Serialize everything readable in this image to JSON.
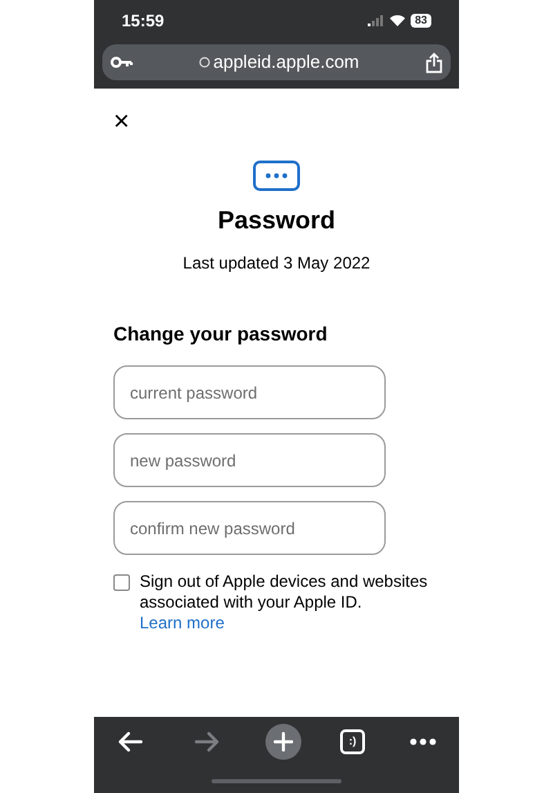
{
  "status_bar": {
    "time": "15:59",
    "battery": "83"
  },
  "address_bar": {
    "url": "appleid.apple.com"
  },
  "page": {
    "close": "×",
    "title": "Password",
    "subtitle": "Last updated 3 May 2022",
    "section_title": "Change your password",
    "fields": [
      {
        "placeholder": "current password"
      },
      {
        "placeholder": "new password"
      },
      {
        "placeholder": "confirm new password"
      }
    ],
    "sign_out": {
      "checked": false,
      "text": "Sign out of Apple devices and websites associated with your Apple ID.",
      "link": "Learn more"
    }
  },
  "toolbar": [
    {
      "kind": "back",
      "disabled": false
    },
    {
      "kind": "forward",
      "disabled": true
    },
    {
      "kind": "new-tab",
      "disabled": false
    },
    {
      "kind": "tabs",
      "disabled": false,
      "label": ":)"
    },
    {
      "kind": "more",
      "disabled": false
    }
  ]
}
